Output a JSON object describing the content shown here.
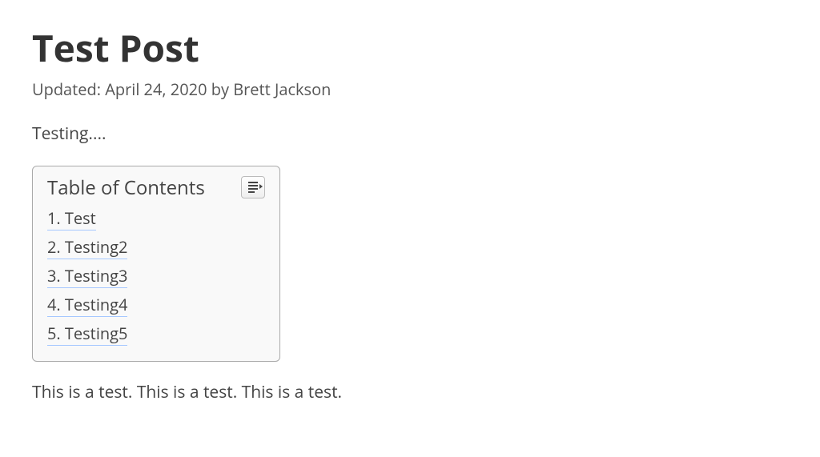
{
  "post": {
    "title": "Test Post",
    "meta": "Updated: April 24, 2020 by Brett Jackson",
    "intro": "Testing....",
    "paragraph": "This is a test. This is a test. This is a test."
  },
  "toc": {
    "title": "Table of Contents",
    "items": [
      {
        "number": "1.",
        "label": "Test"
      },
      {
        "number": "2.",
        "label": "Testing2"
      },
      {
        "number": "3.",
        "label": "Testing3"
      },
      {
        "number": "4.",
        "label": "Testing4"
      },
      {
        "number": "5.",
        "label": "Testing5"
      }
    ]
  }
}
